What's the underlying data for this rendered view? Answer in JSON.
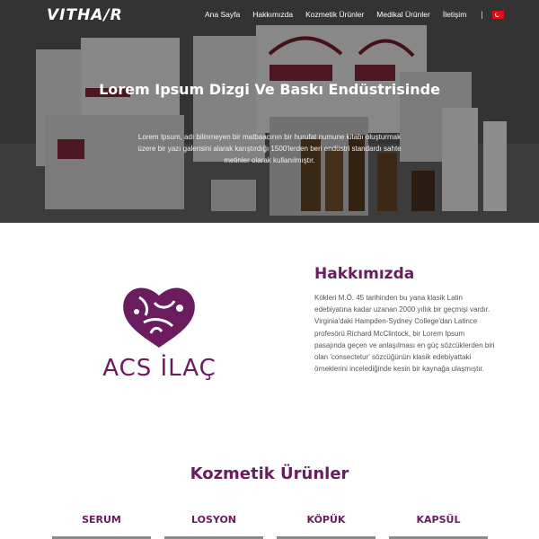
{
  "brand": {
    "logo_text": "VITHA/R"
  },
  "nav": {
    "items": [
      {
        "label": "Ana Sayfa"
      },
      {
        "label": "Hakkımızda"
      },
      {
        "label": "Kozmetik Ürünler"
      },
      {
        "label": "Medikal Ürünler"
      },
      {
        "label": "İletişim"
      }
    ],
    "separator": "|",
    "language": "tr-flag-icon"
  },
  "hero": {
    "title": "Lorem Ipsum Dizgi Ve Baskı Endüstrisinde",
    "text": "Lorem Ipsum, adı bilinmeyen bir matbaacının bir hurufat numune kitabı oluşturmak üzere bir yazı galerisini alarak karıştırdığı 1500'lerden beri endüstri standardı sahte metinler olarak kullanılmıştır."
  },
  "about": {
    "logo_text": "ACS İLAÇ",
    "title": "Hakkımızda",
    "text": "Kökleri M.Ö. 45 tarihinden bu yana klasik Latin edebiyatına kadar uzanan 2000 yıllık bir geçmişi vardır. Virginia'daki Hampden-Sydney College'dan Latince profesörü Richard McClintock, bir Lorem Ipsum pasajında geçen ve anlaşılması en güç sözcüklerden biri olan 'consectetur' sözcüğünün klasik edebiyattaki örneklerini incelediğinde kesin bir kaynağa ulaşmıştır."
  },
  "products": {
    "title": "Kozmetik Ürünler",
    "categories": [
      {
        "label": "SERUM"
      },
      {
        "label": "LOSYON"
      },
      {
        "label": "KÖPÜK"
      },
      {
        "label": "KAPSÜL"
      }
    ]
  },
  "colors": {
    "accent": "#6b1c5f",
    "hero_overlay": "#2a2a2a"
  }
}
